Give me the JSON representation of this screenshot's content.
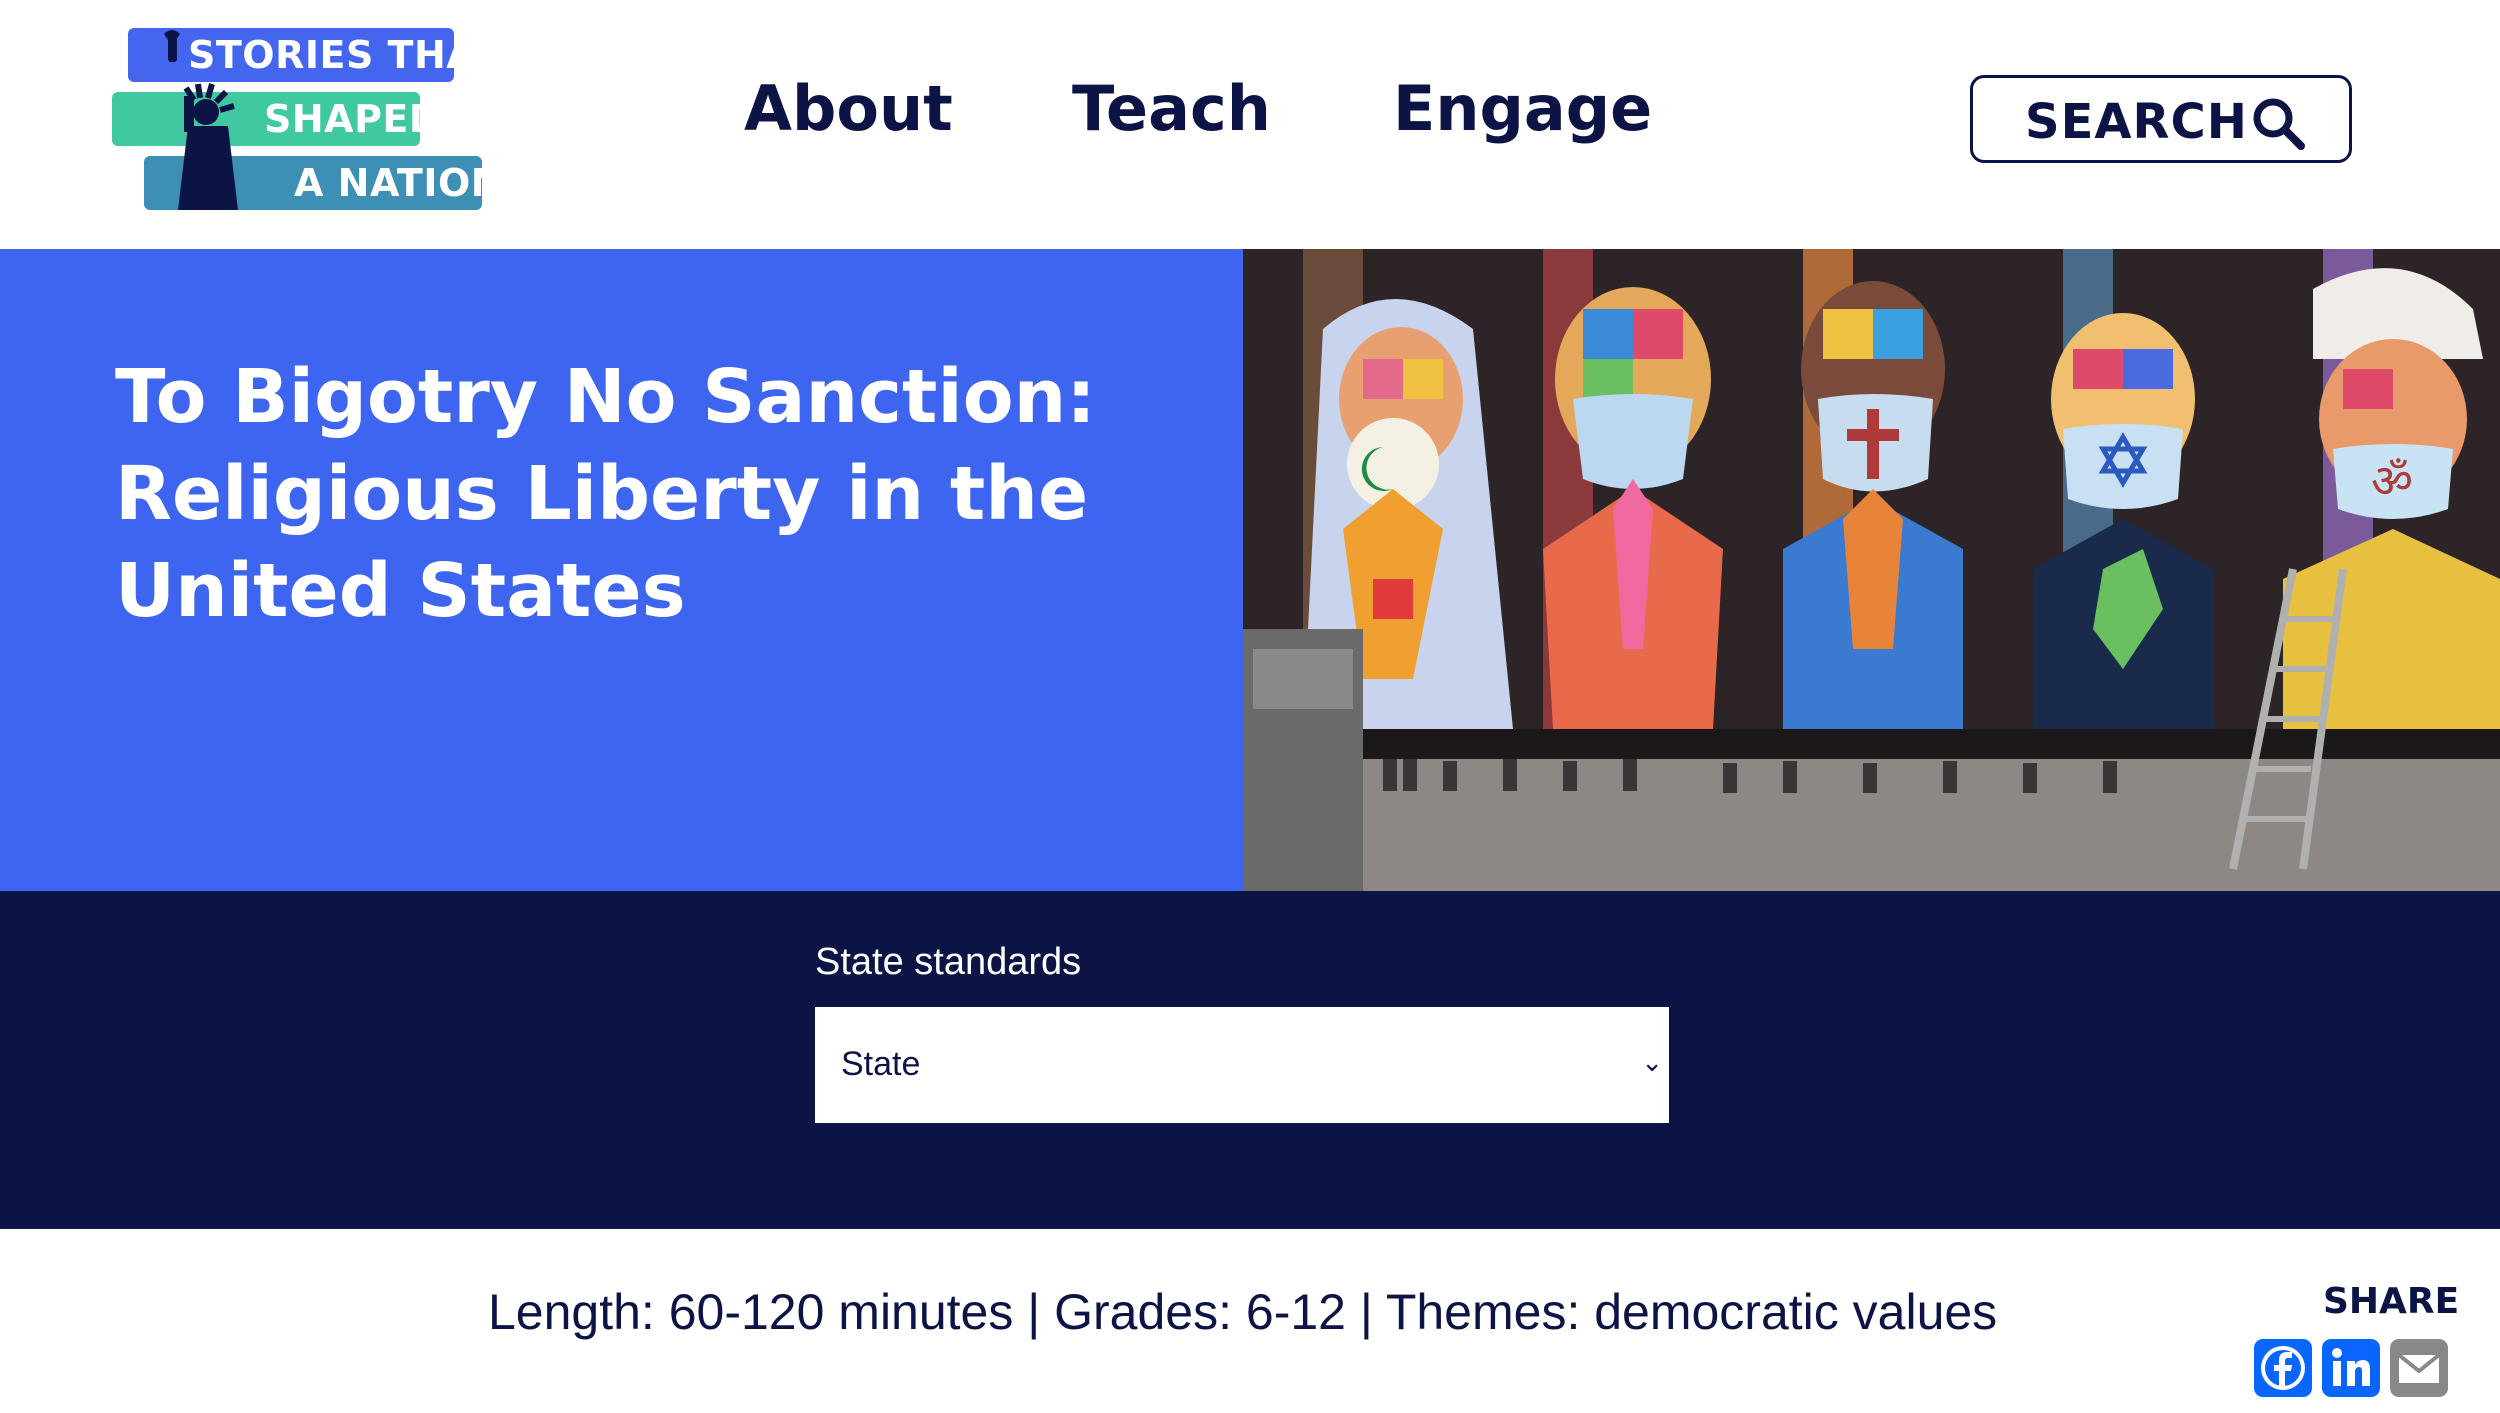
{
  "logo": {
    "line1": "STORIES THAT",
    "line2": "SHAPED",
    "line3": "A NATION"
  },
  "nav": {
    "items": [
      {
        "label": "About"
      },
      {
        "label": "Teach"
      },
      {
        "label": "Engage"
      }
    ]
  },
  "search": {
    "label": "SEARCH",
    "icon": "search-icon"
  },
  "hero": {
    "title_line1": "To Bigotry No Sanction:",
    "title_line2": "Religious Liberty in the",
    "title_line3": "United States"
  },
  "standards": {
    "label": "State standards",
    "select_value": "State",
    "icon": "chevron-down-icon"
  },
  "meta": {
    "text": "Length: 60-120 minutes | Grades: 6-12 | Themes: democratic values"
  },
  "share": {
    "label": "SHARE",
    "icons": [
      "facebook-icon",
      "linkedin-icon",
      "email-icon"
    ]
  },
  "colors": {
    "navy": "#0c1446",
    "hero_blue": "#3e65f0",
    "share_blue": "#0866ff",
    "email_gray": "#888888"
  }
}
